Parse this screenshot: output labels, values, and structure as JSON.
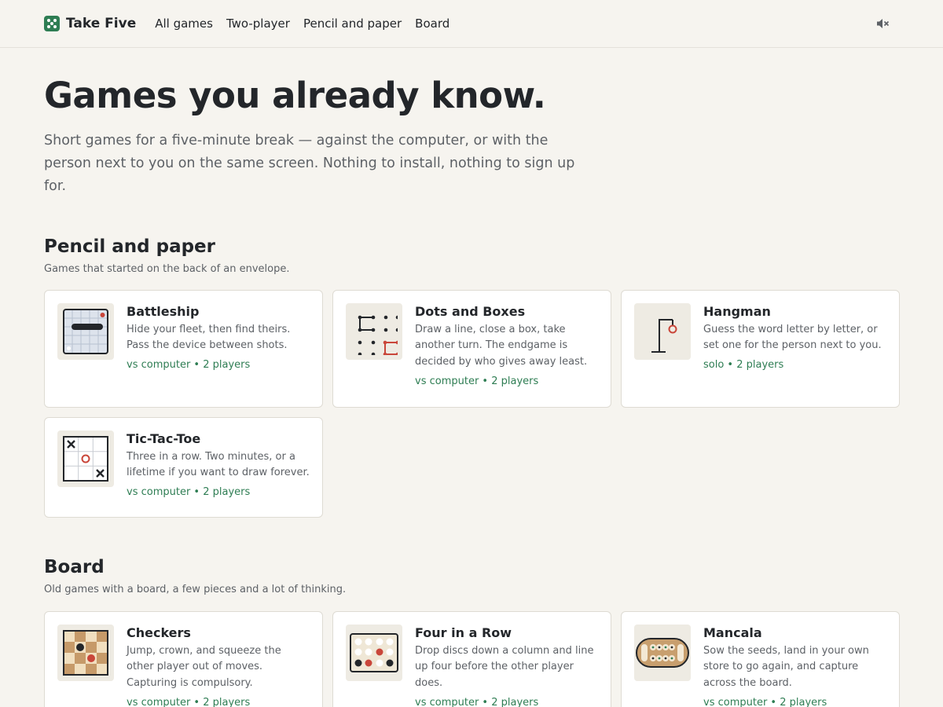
{
  "header": {
    "brand": "Take Five",
    "nav": [
      "All games",
      "Two-player",
      "Pencil and paper",
      "Board"
    ]
  },
  "hero": {
    "title": "Games you already know.",
    "lede": "Short games for a five-minute break — against the computer, or with the person next to you on the same screen. Nothing to install, nothing to sign up for."
  },
  "sections": [
    {
      "title": "Pencil and paper",
      "subtitle": "Games that started on the back of an envelope.",
      "games": [
        {
          "title": "Battleship",
          "desc": "Hide your fleet, then find theirs. Pass the device between shots.",
          "modes": "vs computer • 2 players",
          "icon": "battleship-grid-icon"
        },
        {
          "title": "Dots and Boxes",
          "desc": "Draw a line, close a box, take another turn. The endgame is decided by who gives away least.",
          "modes": "vs computer • 2 players",
          "icon": "dots-grid-icon"
        },
        {
          "title": "Hangman",
          "desc": "Guess the word letter by letter, or set one for the person next to you.",
          "modes": "solo • 2 players",
          "icon": "gallows-icon"
        },
        {
          "title": "Tic-Tac-Toe",
          "desc": "Three in a row. Two minutes, or a lifetime if you want to draw forever.",
          "modes": "vs computer • 2 players",
          "icon": "tictactoe-board-icon"
        }
      ]
    },
    {
      "title": "Board",
      "subtitle": "Old games with a board, a few pieces and a lot of thinking.",
      "games": [
        {
          "title": "Checkers",
          "desc": "Jump, crown, and squeeze the other player out of moves. Capturing is compulsory.",
          "modes": "vs computer • 2 players",
          "icon": "checkerboard-icon"
        },
        {
          "title": "Four in a Row",
          "desc": "Drop discs down a column and line up four before the other player does.",
          "modes": "vs computer • 2 players",
          "icon": "four-in-row-board-icon"
        },
        {
          "title": "Mancala",
          "desc": "Sow the seeds, land in your own store to go again, and capture across the board.",
          "modes": "vs computer • 2 players",
          "icon": "mancala-board-icon"
        }
      ]
    }
  ],
  "colors": {
    "accent": "#2e7d53",
    "red": "#c9463a",
    "ink": "#23262a"
  }
}
